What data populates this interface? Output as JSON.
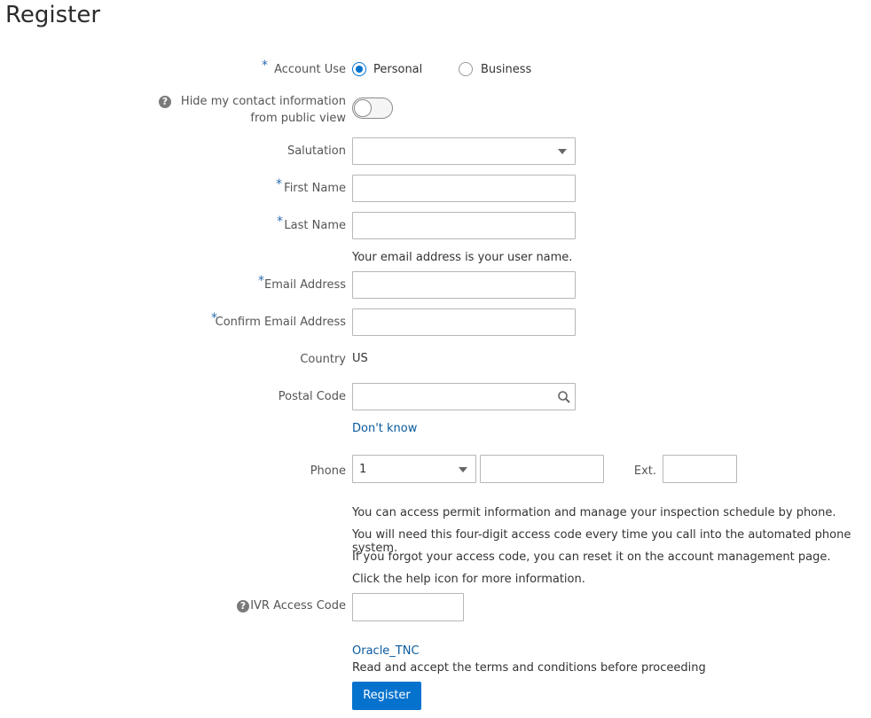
{
  "page": {
    "title": "Register"
  },
  "form": {
    "account_use": {
      "label": "Account Use",
      "options": [
        "Personal",
        "Business"
      ],
      "selected": "Personal"
    },
    "hide_contact": {
      "label_line1": "Hide my contact information",
      "label_line2": "from public view",
      "value": false
    },
    "salutation": {
      "label": "Salutation",
      "value": ""
    },
    "first_name": {
      "label": "First Name",
      "value": ""
    },
    "last_name": {
      "label": "Last Name",
      "value": ""
    },
    "email_hint": "Your email address is your user name.",
    "email": {
      "label": "Email Address",
      "value": ""
    },
    "confirm_email": {
      "label": "Confirm Email Address",
      "value": ""
    },
    "country": {
      "label": "Country",
      "value": "US"
    },
    "postal_code": {
      "label": "Postal Code",
      "value": ""
    },
    "dont_know_link": "Don't know",
    "phone": {
      "label": "Phone",
      "country_code": "1",
      "number": "",
      "ext_label": "Ext.",
      "ext": ""
    },
    "ivr_info": [
      "You can access permit information and manage your inspection schedule by phone.",
      "You will need this four-digit access code every time you call into the automated phone system.",
      "If you forgot your access code, you can reset it on the account management page.",
      "Click the help icon for more information."
    ],
    "ivr_access_code": {
      "label": "IVR Access Code",
      "value": ""
    },
    "terms_link": "Oracle_TNC",
    "terms_text": "Read and accept the terms and conditions before proceeding",
    "submit_label": "Register",
    "required_mark": "*"
  },
  "colors": {
    "accent": "#0572ce",
    "link": "#0a5a9c",
    "required": "#2b6cb0"
  },
  "icons": {
    "help": "question-circle-icon",
    "search": "search-icon",
    "dropdown": "caret-down-icon"
  }
}
